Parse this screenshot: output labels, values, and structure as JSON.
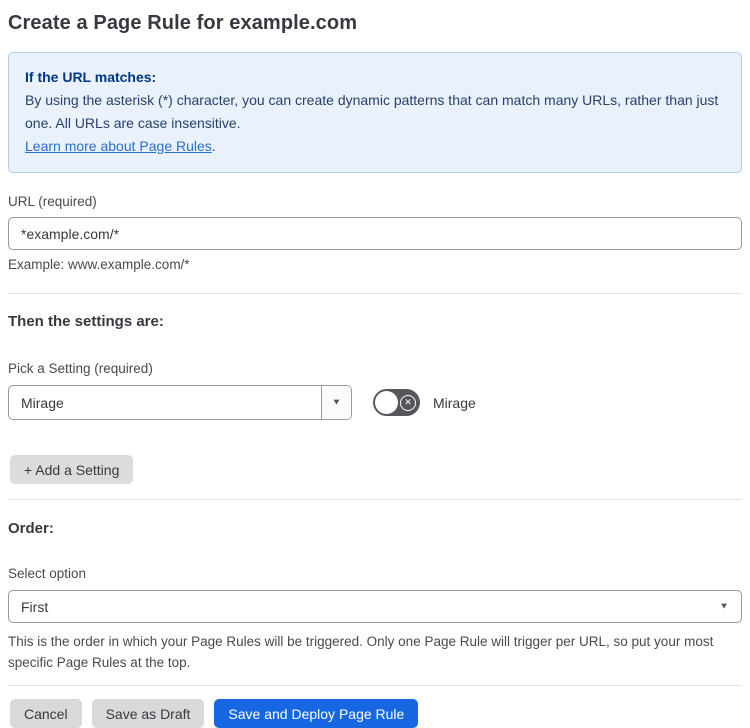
{
  "page": {
    "title": "Create a Page Rule for example.com"
  },
  "info_box": {
    "heading": "If the URL matches:",
    "body": "By using the asterisk (*) character, you can create dynamic patterns that can match many URLs, rather than just one. All URLs are case insensitive.",
    "link_label": "Learn more about Page Rules",
    "link_suffix": "."
  },
  "url_field": {
    "label": "URL (required)",
    "value": "*example.com/*",
    "helper": "Example: www.example.com/*"
  },
  "settings_section": {
    "heading": "Then the settings are:",
    "picker_label": "Pick a Setting (required)",
    "picker_value": "Mirage",
    "toggle_label": "Mirage",
    "toggle_state": "off",
    "add_button_label": "+ Add a Setting"
  },
  "order_section": {
    "heading": "Order:",
    "select_label": "Select option",
    "select_value": "First",
    "helper": "This is the order in which your Page Rules will be triggered. Only one Page Rule will trigger per URL, so put your most specific Page Rules at the top."
  },
  "footer": {
    "cancel_label": "Cancel",
    "save_draft_label": "Save as Draft",
    "save_deploy_label": "Save and Deploy Page Rule"
  },
  "icons": {
    "dropdown_caret": "▼",
    "toggle_x": "✕"
  },
  "colors": {
    "info_bg": "#e9f2fc",
    "info_border": "#b3cde9",
    "info_heading_text": "#003681",
    "info_body_text": "#27406e",
    "link": "#2c6ecb",
    "primary_button": "#1767e2",
    "toggle_off": "#56565c",
    "gray_button": "#d9d9d9"
  }
}
